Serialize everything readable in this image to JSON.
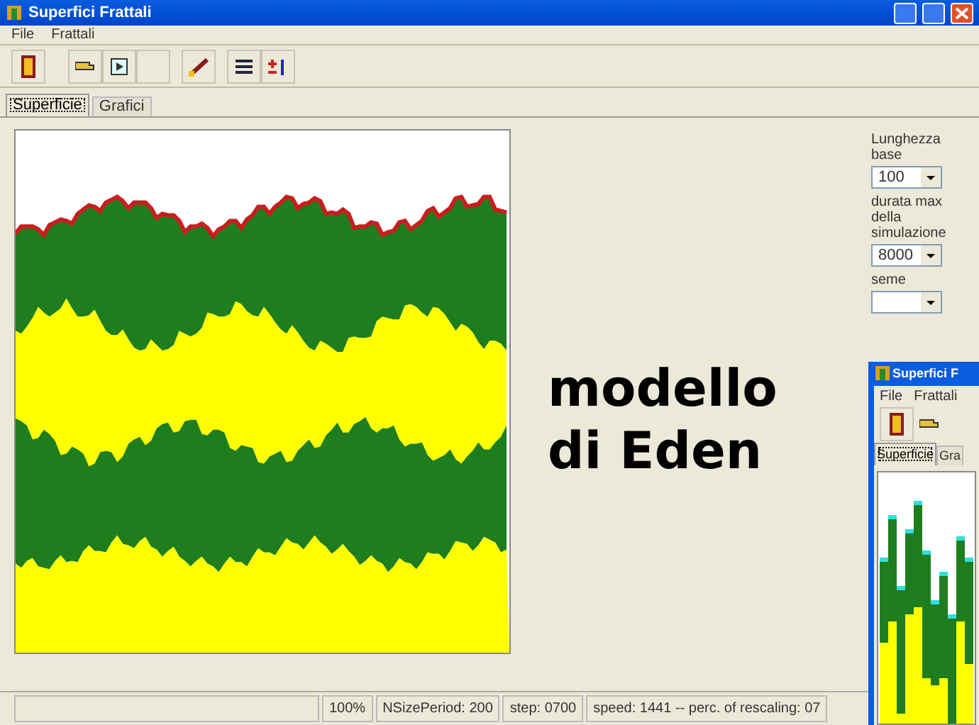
{
  "window": {
    "title": "Superfici Frattali"
  },
  "menu": [
    "File",
    "Frattali"
  ],
  "tabs": [
    {
      "label": "Superficie",
      "selected": true
    },
    {
      "label": "Grafici",
      "selected": false
    }
  ],
  "sidebar": {
    "fields": [
      {
        "label": "Lunghezza base",
        "value": "100"
      },
      {
        "label": "durata max della simulazione",
        "value": "8000"
      },
      {
        "label": "seme"
      }
    ]
  },
  "overlay_caption": [
    "modello",
    "di Eden"
  ],
  "status_bar": [
    "100%",
    "NSizePeriod: 200",
    "step: 0700",
    "speed: 1441 -- perc. of rescaling: 07"
  ],
  "second_window": {
    "title": "Superfici F",
    "menu": [
      "File",
      "Frattali"
    ],
    "tabs": [
      {
        "label": "Superficie",
        "selected": true
      },
      {
        "label": "Gra",
        "selected": false
      }
    ]
  }
}
